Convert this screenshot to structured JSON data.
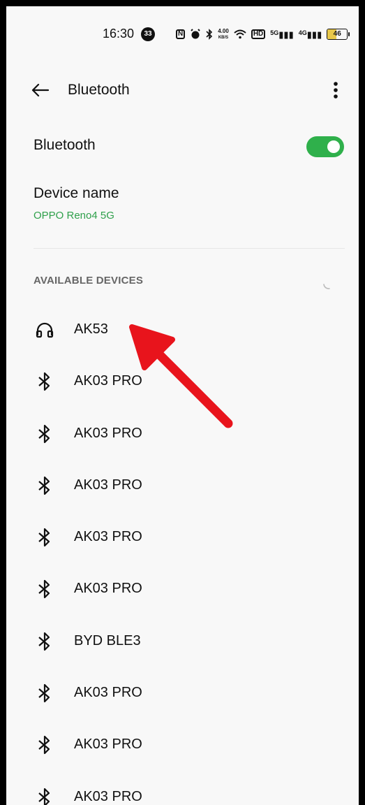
{
  "status_bar": {
    "time": "16:30",
    "notification_count": "33",
    "nfc_label": "N",
    "speed_value": "4.00",
    "speed_unit": "KB/S",
    "hd_label": "HD",
    "signal1_label": "5G",
    "signal2_label": "4G",
    "battery_level": "46"
  },
  "header": {
    "title": "Bluetooth",
    "back_icon": "arrow-left-icon",
    "menu_icon": "more-vertical-icon"
  },
  "bluetooth_toggle": {
    "label": "Bluetooth",
    "enabled": true,
    "on_color": "#2fb04b"
  },
  "device_name": {
    "label": "Device name",
    "value": "OPPO Reno4 5G",
    "value_color": "#2fa04b"
  },
  "available_devices": {
    "section_title": "AVAILABLE DEVICES",
    "devices": [
      {
        "name": "AK53",
        "icon": "headphones-icon"
      },
      {
        "name": "AK03 PRO",
        "icon": "bluetooth-icon"
      },
      {
        "name": "AK03 PRO",
        "icon": "bluetooth-icon"
      },
      {
        "name": "AK03 PRO",
        "icon": "bluetooth-icon"
      },
      {
        "name": "AK03 PRO",
        "icon": "bluetooth-icon"
      },
      {
        "name": "AK03 PRO",
        "icon": "bluetooth-icon"
      },
      {
        "name": "BYD BLE3",
        "icon": "bluetooth-icon"
      },
      {
        "name": "AK03 PRO",
        "icon": "bluetooth-icon"
      },
      {
        "name": "AK03 PRO",
        "icon": "bluetooth-icon"
      },
      {
        "name": "AK03 PRO",
        "icon": "bluetooth-icon"
      }
    ]
  },
  "annotation": {
    "arrow_color": "#e8141c"
  }
}
